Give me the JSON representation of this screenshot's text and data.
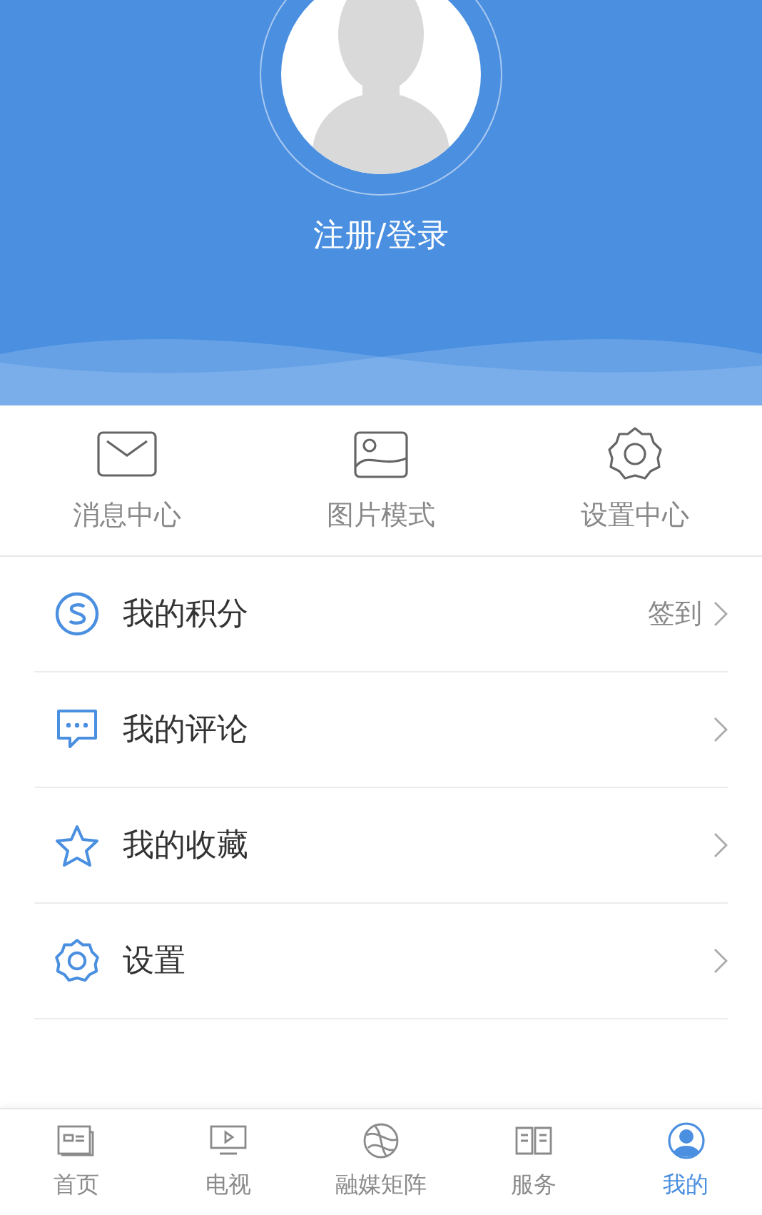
{
  "profile": {
    "login_label": "注册/登录"
  },
  "quick_actions": [
    {
      "label": "消息中心"
    },
    {
      "label": "图片模式"
    },
    {
      "label": "设置中心"
    }
  ],
  "menu": [
    {
      "label": "我的积分",
      "action": "签到"
    },
    {
      "label": "我的评论"
    },
    {
      "label": "我的收藏"
    },
    {
      "label": "设置"
    }
  ],
  "tab_bar": [
    {
      "label": "首页",
      "selected": false
    },
    {
      "label": "电视",
      "selected": false
    },
    {
      "label": "融媒矩阵",
      "selected": false
    },
    {
      "label": "服务",
      "selected": false
    },
    {
      "label": "我的",
      "selected": true
    }
  ]
}
